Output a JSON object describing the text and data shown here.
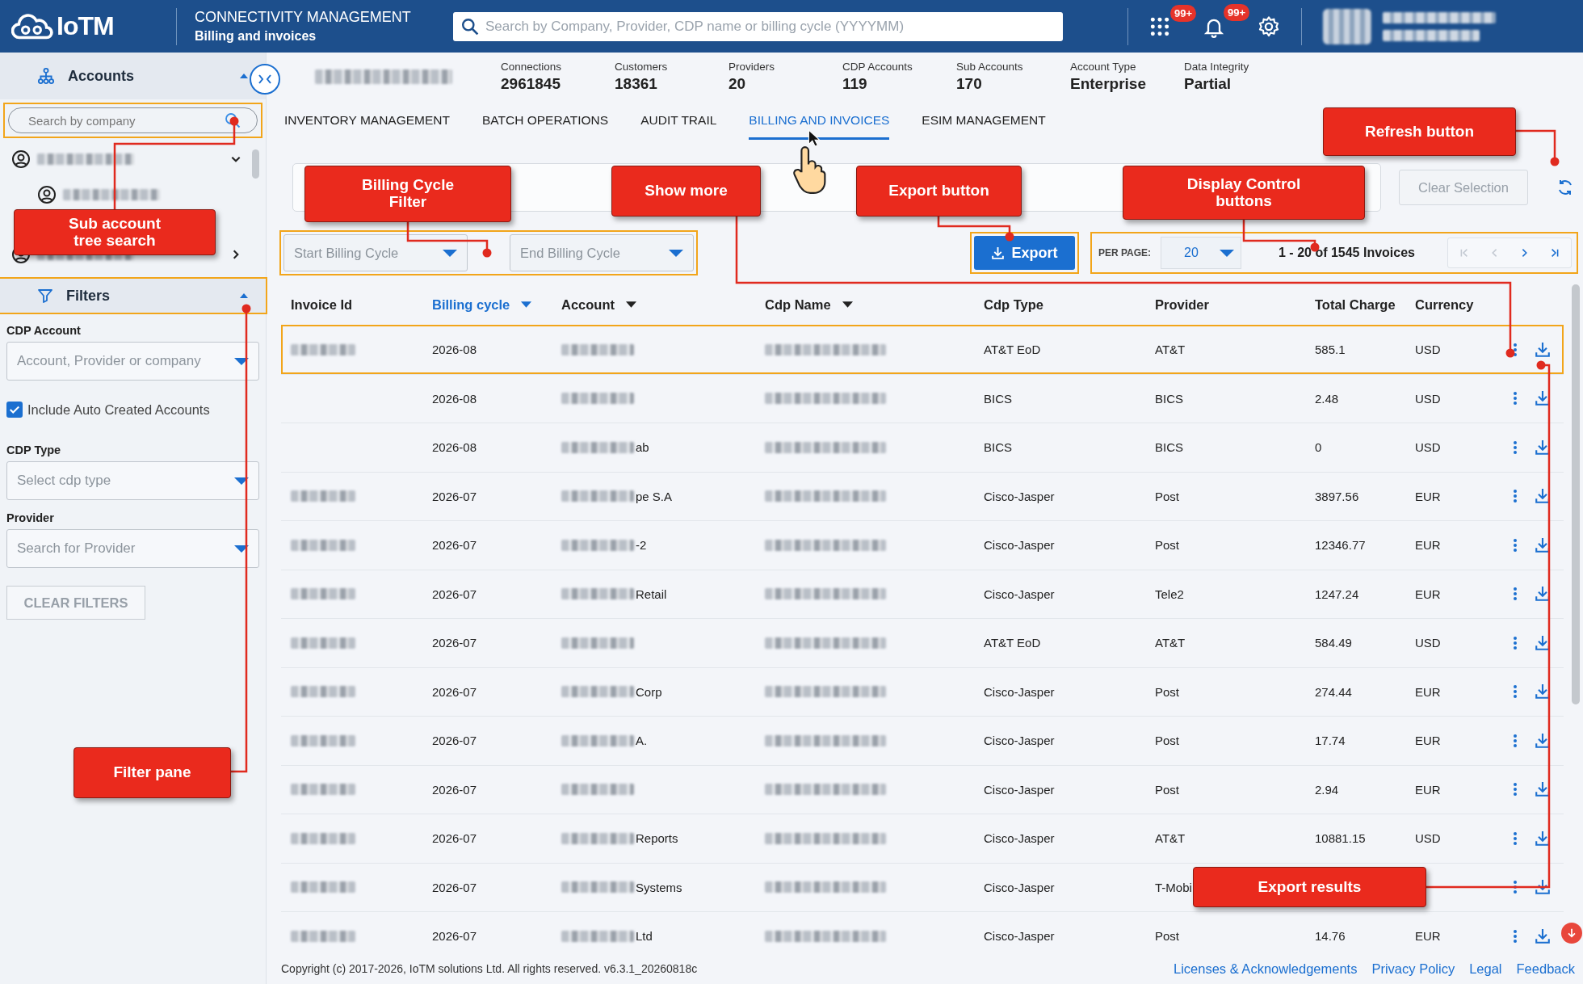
{
  "header": {
    "logo": "IoTM",
    "title": "CONNECTIVITY MANAGEMENT",
    "subtitle": "Billing and invoices",
    "search": {
      "placeholder": "Search by Company, Provider, CDP name or billing cycle (YYYYMM)"
    },
    "apps_badge": "99+",
    "notifications_badge": "99+"
  },
  "sidebar": {
    "accounts": {
      "title": "Accounts",
      "expanded": true,
      "search": {
        "placeholder": "Search by company",
        "highlighted": true
      },
      "tree": [
        {
          "redacted": true,
          "expanded": true,
          "children": [
            {
              "redacted": true
            }
          ]
        },
        {
          "redacted": true,
          "expanded": false
        }
      ]
    },
    "filters": {
      "title": "Filters",
      "expanded": true,
      "highlighted": true,
      "fields": [
        {
          "kind": "select",
          "label": "CDP Account",
          "placeholder": "Account, Provider or company"
        },
        {
          "kind": "checkbox",
          "label": "Include Auto Created Accounts",
          "checked": true
        },
        {
          "kind": "select",
          "label": "CDP Type",
          "placeholder": "Select cdp type"
        },
        {
          "kind": "select",
          "label": "Provider",
          "placeholder": "Search for Provider"
        }
      ],
      "clear_button": {
        "label": "CLEAR FILTERS",
        "disabled": true
      }
    }
  },
  "stats": [
    {
      "label": "Connections",
      "value": "2961845"
    },
    {
      "label": "Customers",
      "value": "18361"
    },
    {
      "label": "Providers",
      "value": "20"
    },
    {
      "label": "CDP Accounts",
      "value": "119"
    },
    {
      "label": "Sub Accounts",
      "value": "170"
    },
    {
      "label": "Account Type",
      "value": "Enterprise"
    },
    {
      "label": "Data Integrity",
      "value": "Partial"
    }
  ],
  "tabs": [
    {
      "label": "INVENTORY MANAGEMENT",
      "selected": false
    },
    {
      "label": "BATCH OPERATIONS",
      "selected": false
    },
    {
      "label": "AUDIT TRAIL",
      "selected": false
    },
    {
      "label": "BILLING AND INVOICES",
      "selected": true
    },
    {
      "label": "ESIM MANAGEMENT",
      "selected": false
    }
  ],
  "clear_selection": {
    "label": "Clear Selection",
    "disabled": true
  },
  "billing_cycle_filter": {
    "highlighted": true,
    "start": {
      "placeholder": "Start Billing Cycle"
    },
    "end": {
      "placeholder": "End Billing Cycle"
    }
  },
  "export_button": {
    "label": "Export",
    "highlighted": true
  },
  "pagination": {
    "highlighted": true,
    "per_page_label": "PER PAGE:",
    "per_page": "20",
    "range": "1 - 20 of 1545 Invoices",
    "buttons": [
      {
        "kind": "first",
        "disabled": true
      },
      {
        "kind": "prev",
        "disabled": true
      },
      {
        "kind": "next",
        "disabled": false
      },
      {
        "kind": "last",
        "disabled": false
      }
    ]
  },
  "table": {
    "columns": [
      {
        "label": "Invoice Id",
        "sortable": false,
        "selected": false
      },
      {
        "label": "Billing cycle",
        "sortable": true,
        "selected": true
      },
      {
        "label": "Account",
        "sortable": true,
        "selected": false
      },
      {
        "label": "Cdp Name",
        "sortable": true,
        "selected": false
      },
      {
        "label": "Cdp Type",
        "sortable": false,
        "selected": false
      },
      {
        "label": "Provider",
        "sortable": false,
        "selected": false
      },
      {
        "label": "Total Charge",
        "sortable": false,
        "selected": false
      },
      {
        "label": "Currency",
        "sortable": false,
        "selected": false
      }
    ],
    "rows": [
      {
        "highlighted": true,
        "id_redacted": true,
        "cycle": "2026-08",
        "cdp_type": "AT&T EoD",
        "provider": "AT&T",
        "total": "585.1",
        "currency": "USD"
      },
      {
        "highlighted": false,
        "id_redacted": false,
        "cycle": "2026-08",
        "cdp_type": "BICS",
        "provider": "BICS",
        "total": "2.48",
        "currency": "USD"
      },
      {
        "highlighted": false,
        "id_redacted": false,
        "cycle": "2026-08",
        "account": "ab",
        "cdp_type": "BICS",
        "provider": "BICS",
        "total": "0",
        "currency": "USD"
      },
      {
        "highlighted": false,
        "id_redacted": true,
        "cycle": "2026-07",
        "account": "pe S.A",
        "cdp_type": "Cisco-Jasper",
        "provider": "Post",
        "total": "3897.56",
        "currency": "EUR"
      },
      {
        "highlighted": false,
        "id_redacted": true,
        "cycle": "2026-07",
        "account": "-2",
        "cdp_type": "Cisco-Jasper",
        "provider": "Post",
        "total": "12346.77",
        "currency": "EUR"
      },
      {
        "highlighted": false,
        "id_redacted": true,
        "cycle": "2026-07",
        "account": "Retail",
        "cdp_type": "Cisco-Jasper",
        "provider": "Tele2",
        "total": "1247.24",
        "currency": "EUR"
      },
      {
        "highlighted": false,
        "id_redacted": true,
        "cycle": "2026-07",
        "cdp_type": "AT&T EoD",
        "provider": "AT&T",
        "total": "584.49",
        "currency": "USD"
      },
      {
        "highlighted": false,
        "id_redacted": true,
        "cycle": "2026-07",
        "account": "Corp",
        "cdp_type": "Cisco-Jasper",
        "provider": "Post",
        "total": "274.44",
        "currency": "EUR"
      },
      {
        "highlighted": false,
        "id_redacted": true,
        "cycle": "2026-07",
        "account": "A.",
        "cdp_type": "Cisco-Jasper",
        "provider": "Post",
        "total": "17.74",
        "currency": "EUR"
      },
      {
        "highlighted": false,
        "id_redacted": true,
        "cycle": "2026-07",
        "cdp_type": "Cisco-Jasper",
        "provider": "Post",
        "total": "2.94",
        "currency": "EUR"
      },
      {
        "highlighted": false,
        "id_redacted": true,
        "cycle": "2026-07",
        "account": "Reports",
        "cdp_type": "Cisco-Jasper",
        "provider": "AT&T",
        "total": "10881.15",
        "currency": "USD"
      },
      {
        "highlighted": false,
        "id_redacted": true,
        "cycle": "2026-07",
        "account": "Systems",
        "cdp_type": "Cisco-Jasper",
        "provider": "T-Mobi"
      },
      {
        "highlighted": false,
        "id_redacted": true,
        "cycle": "2026-07",
        "account": "Ltd",
        "cdp_type": "Cisco-Jasper",
        "provider": "Post",
        "total": "14.76",
        "currency": "EUR"
      }
    ]
  },
  "footer": {
    "copyright": "Copyright (c) 2017-2026, IoTM solutions Ltd. All rights reserved. v6.3.1_20260818c",
    "links": [
      "Licenses & Acknowledgements",
      "Privacy Policy",
      "Legal",
      "Feedback"
    ]
  },
  "annotations": [
    {
      "text": "Refresh button"
    },
    {
      "text": "Billing Cycle Filter"
    },
    {
      "text": "Show more"
    },
    {
      "text": "Export button"
    },
    {
      "text": "Display Control buttons"
    },
    {
      "text": "Sub account tree search"
    },
    {
      "text": "Filter pane"
    },
    {
      "text": "Export results"
    }
  ]
}
